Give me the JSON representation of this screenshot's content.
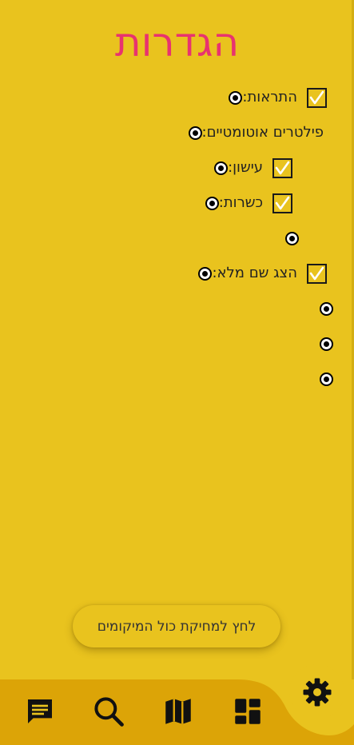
{
  "page": {
    "title": "הגדרות"
  },
  "settings": {
    "notifications_label": "התראות:",
    "auto_filters_label": "פילטרים אוטומטיים:",
    "smoking_label": "עישון:",
    "kosher_label": "כשרות:",
    "show_full_name_label": "הצג שם מלא:"
  },
  "actions": {
    "clear_all_label": "לחץ למחיקת כול המיקומים"
  },
  "nav": {
    "items": [
      {
        "icon": "chat-icon"
      },
      {
        "icon": "search-icon"
      },
      {
        "icon": "map-icon"
      },
      {
        "icon": "dashboard-icon"
      }
    ],
    "active": {
      "icon": "gear-icon"
    }
  },
  "colors": {
    "background": "#e9c31e",
    "title": "#e8336f",
    "bottom_bar": "#dca407",
    "icon": "#111111"
  }
}
